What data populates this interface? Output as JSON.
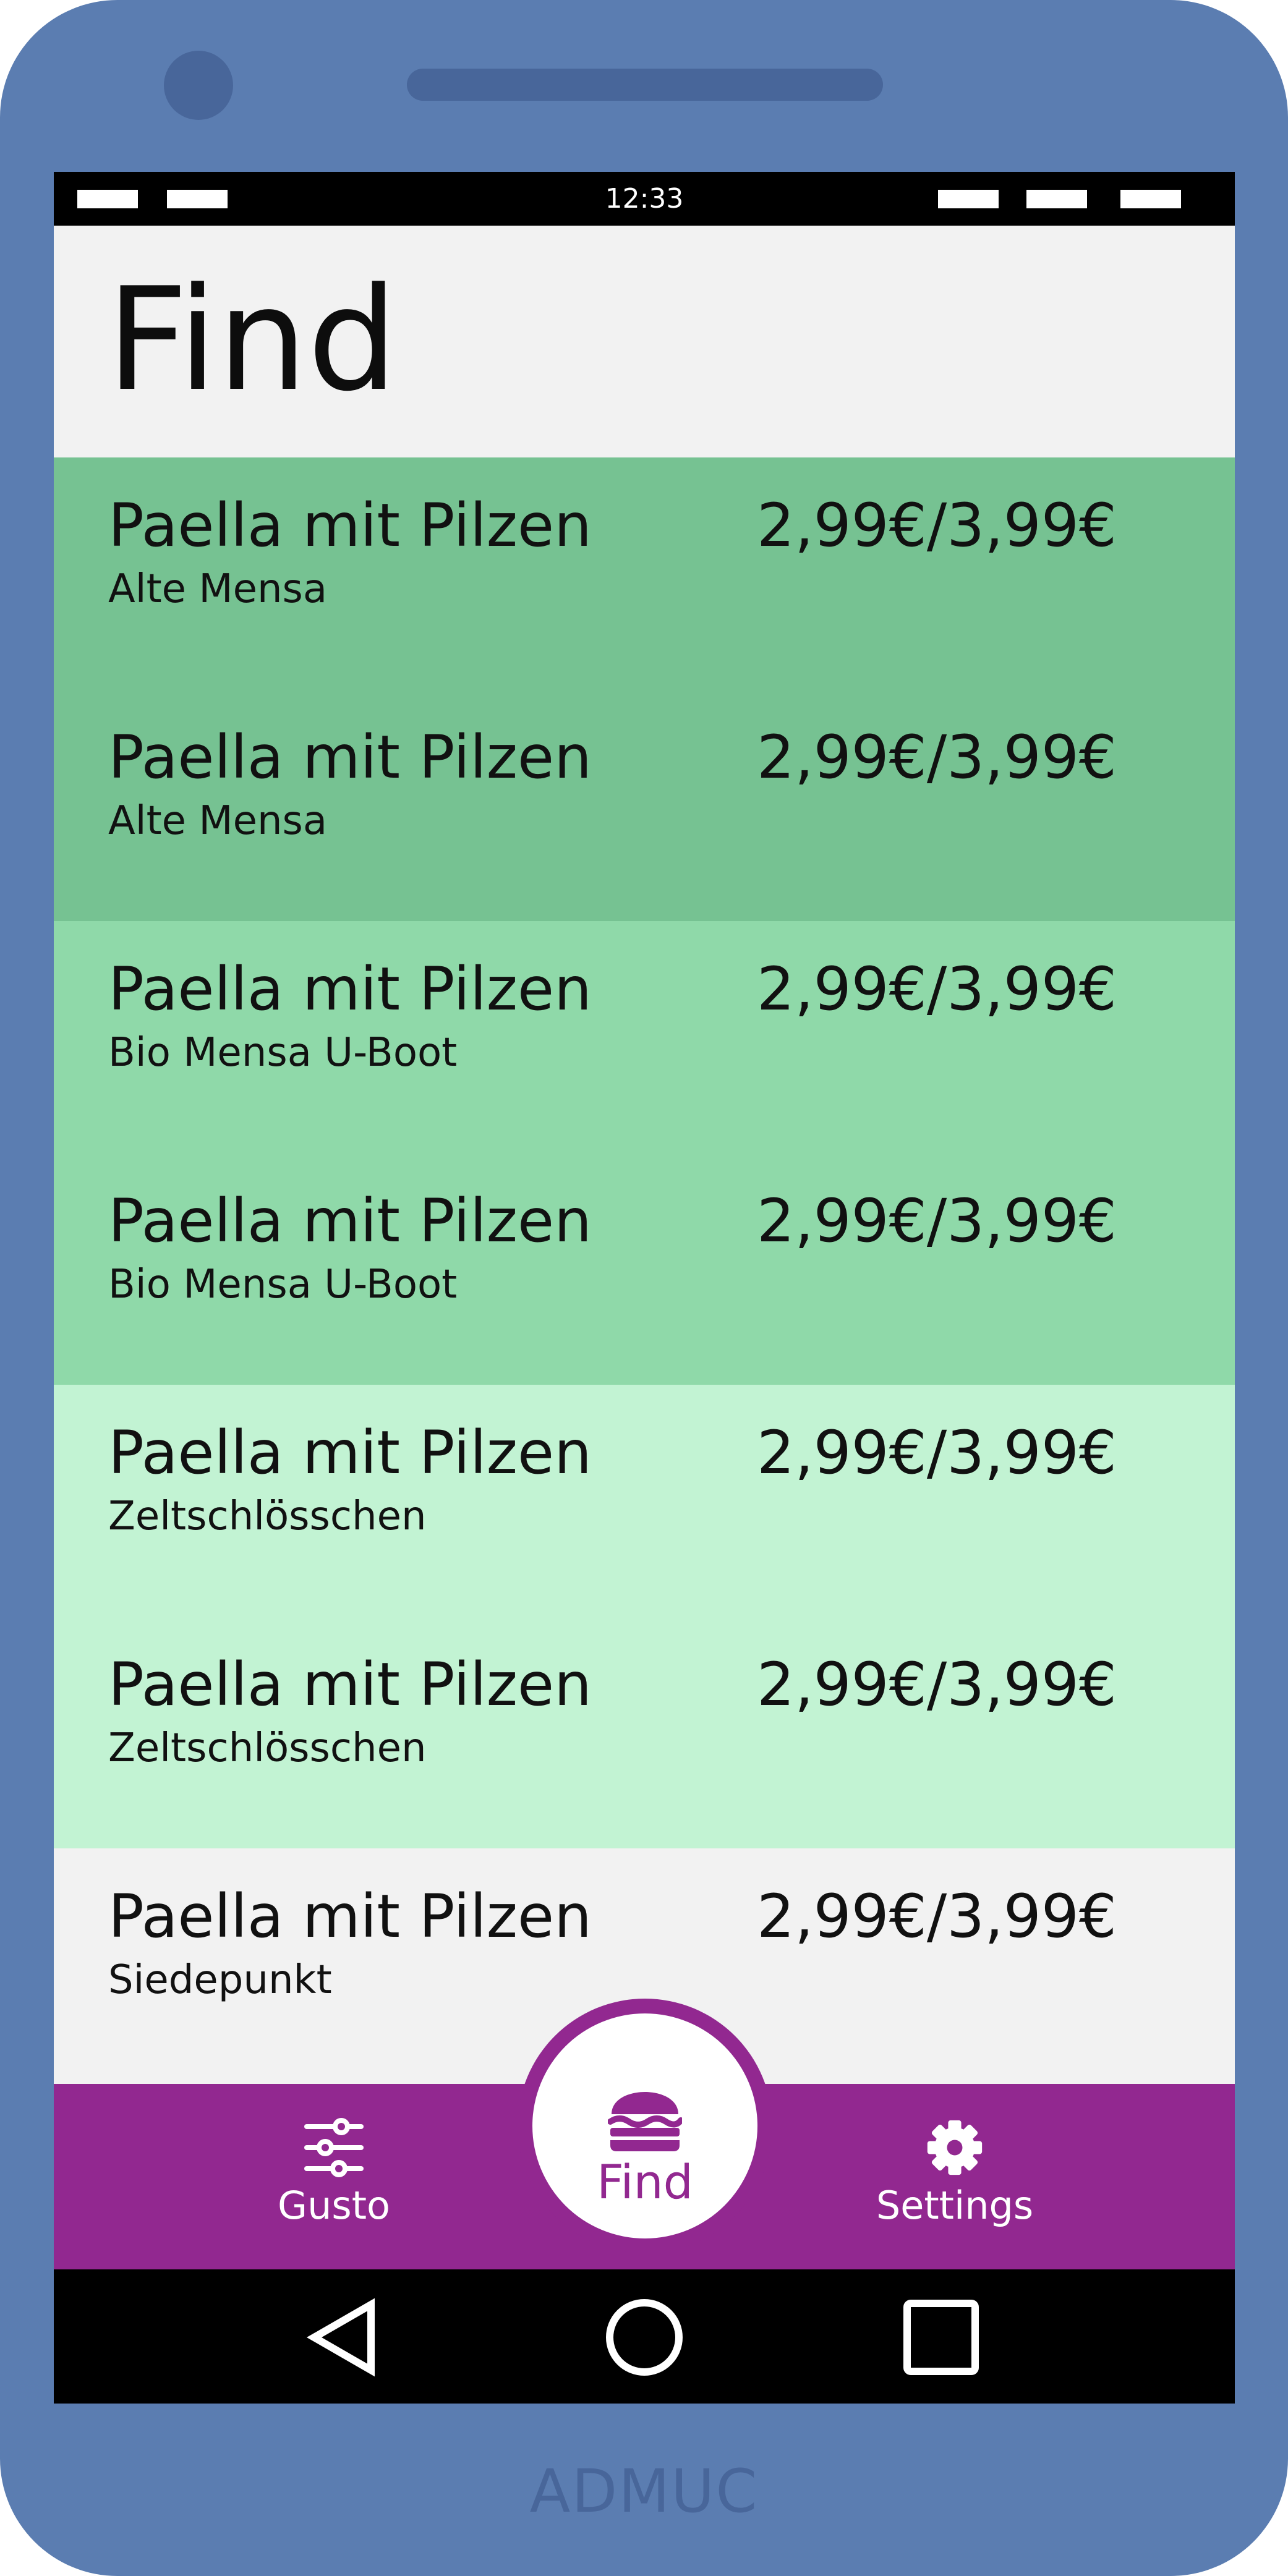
{
  "status_bar": {
    "time": "12:33"
  },
  "header": {
    "title": "Find"
  },
  "meals": [
    {
      "name": "Paella mit Pilzen",
      "location": "Alte Mensa",
      "price": "2,99€/3,99€",
      "color": "#76c292"
    },
    {
      "name": "Paella mit Pilzen",
      "location": "Alte Mensa",
      "price": "2,99€/3,99€",
      "color": "#76c292"
    },
    {
      "name": "Paella mit Pilzen",
      "location": "Bio Mensa U-Boot",
      "price": "2,99€/3,99€",
      "color": "#8fd9a9"
    },
    {
      "name": "Paella mit Pilzen",
      "location": "Bio Mensa U-Boot",
      "price": "2,99€/3,99€",
      "color": "#8fd9a9"
    },
    {
      "name": "Paella mit Pilzen",
      "location": "Zeltschlösschen",
      "price": "2,99€/3,99€",
      "color": "#c2f3d3"
    },
    {
      "name": "Paella mit Pilzen",
      "location": "Zeltschlösschen",
      "price": "2,99€/3,99€",
      "color": "#c2f3d3"
    },
    {
      "name": "Paella mit Pilzen",
      "location": "Siedepunkt",
      "price": "2,99€/3,99€",
      "color": "#f2f2f2"
    }
  ],
  "bottom_nav": {
    "gusto": {
      "label": "Gusto",
      "icon": "sliders-icon"
    },
    "find": {
      "label": "Find",
      "icon": "burger-icon"
    },
    "settings": {
      "label": "Settings",
      "icon": "gear-icon"
    }
  },
  "system_nav": {
    "back_icon": "back-triangle-icon",
    "home_icon": "home-circle-icon",
    "recents_icon": "recents-square-icon"
  },
  "brand": {
    "text": "ADMUC"
  },
  "colors": {
    "phone_frame": "#5b7db1",
    "accent": "#922890"
  }
}
